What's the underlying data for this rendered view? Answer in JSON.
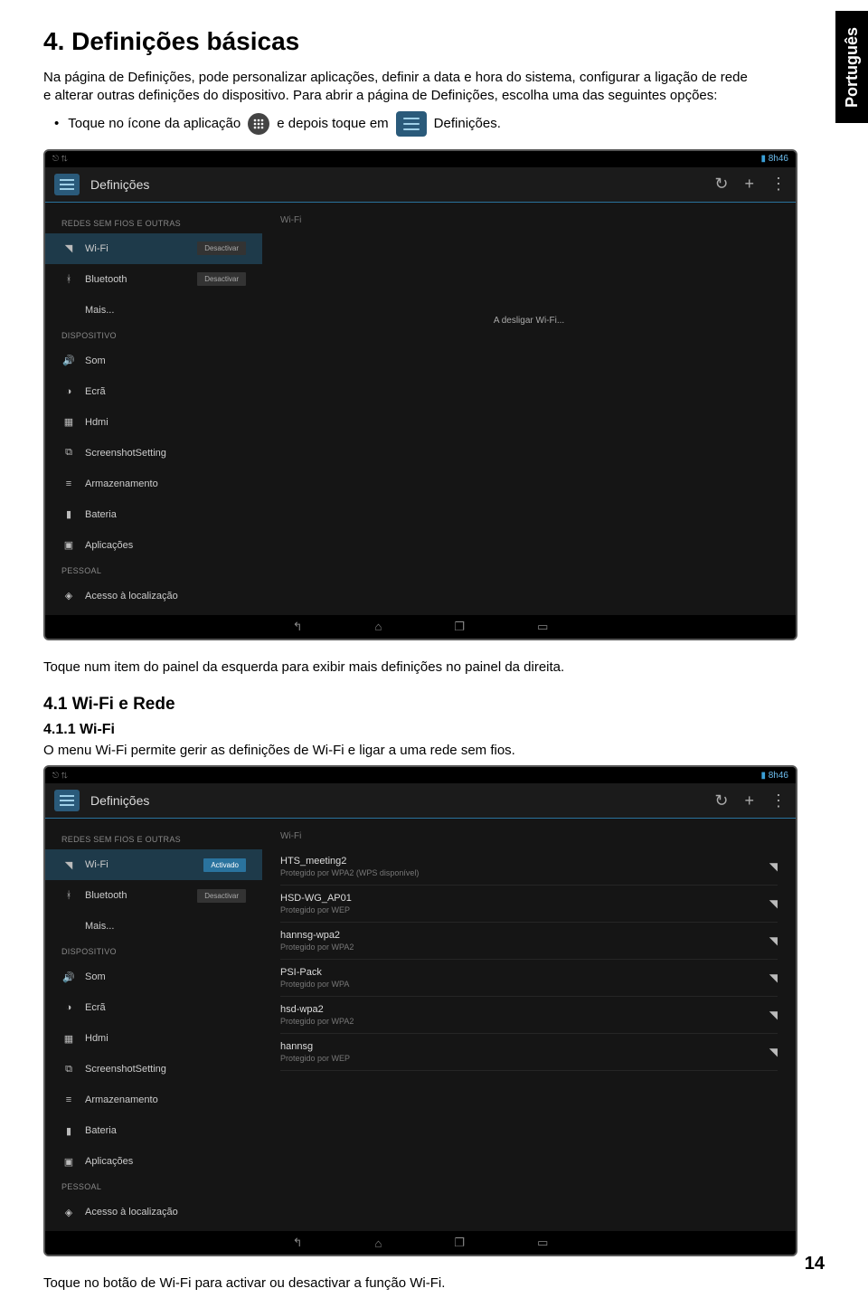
{
  "lang_tab": "Português",
  "heading_main": "4. Definições básicas",
  "intro_para": "Na página de Definições, pode personalizar aplicações, definir a data e hora do sistema, configurar a ligação de rede e alterar outras definições do dispositivo. Para abrir a página de Definições, escolha uma das seguintes opções:",
  "bullet_part1": "Toque no ícone da aplicação",
  "bullet_part2": "e depois toque em",
  "bullet_part3": "Definições.",
  "caption_after_shot1": "Toque num item do painel da esquerda para exibir mais definições no painel da direita.",
  "heading_4_1": "4.1  Wi-Fi e Rede",
  "heading_4_1_1": "4.1.1 Wi-Fi",
  "para_4_1_1": "O menu Wi-Fi permite gerir as definições de Wi-Fi e ligar a uma rede sem fios.",
  "caption_after_shot2": "Toque no botão de Wi-Fi para activar ou desactivar a função Wi-Fi.",
  "page_number": "14",
  "device": {
    "time": "8h46",
    "appbar_title": "Definições",
    "section_redes": "REDES SEM FIOS E OUTRAS",
    "section_dispositivo": "DISPOSITIVO",
    "section_pessoal": "PESSOAL",
    "rows": {
      "wifi": "Wi-Fi",
      "bluetooth": "Bluetooth",
      "mais": "Mais...",
      "som": "Som",
      "ecra": "Ecrã",
      "hdmi": "Hdmi",
      "screenshot": "ScreenshotSetting",
      "armaz": "Armazenamento",
      "bateria": "Bateria",
      "apps": "Aplicações",
      "acesso": "Acesso à localização"
    },
    "toggle_off": "Desactivar",
    "toggle_on": "Activado",
    "content_hd": "Wi-Fi",
    "content_msg": "A desligar Wi-Fi...",
    "networks": [
      {
        "name": "HTS_meeting2",
        "sub": "Protegido por WPA2 (WPS disponível)"
      },
      {
        "name": "HSD-WG_AP01",
        "sub": "Protegido por WEP"
      },
      {
        "name": "hannsg-wpa2",
        "sub": "Protegido por WPA2"
      },
      {
        "name": "PSI-Pack",
        "sub": "Protegido por WPA"
      },
      {
        "name": "hsd-wpa2",
        "sub": "Protegido por WPA2"
      },
      {
        "name": "hannsg",
        "sub": "Protegido por WEP"
      }
    ]
  }
}
